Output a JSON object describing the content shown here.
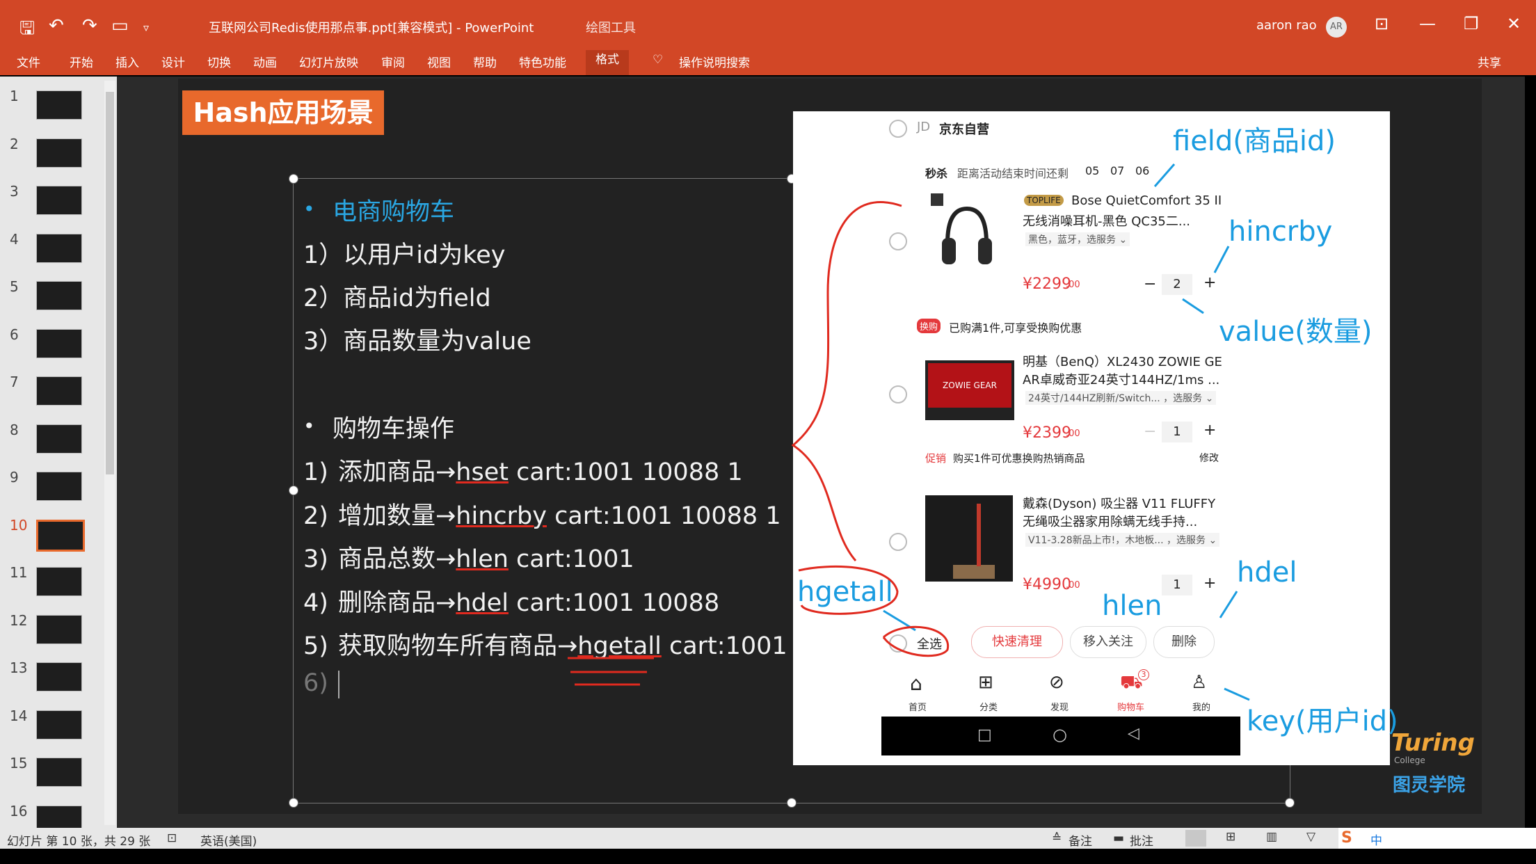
{
  "window": {
    "title": "互联网公司Redis使用那点事.ppt[兼容模式] - PowerPoint",
    "context_tab_group": "绘图工具",
    "user_name": "aaron rao",
    "user_initials": "AR"
  },
  "ribbon": {
    "tabs": [
      "文件",
      "开始",
      "插入",
      "设计",
      "切换",
      "动画",
      "幻灯片放映",
      "审阅",
      "视图",
      "帮助",
      "特色功能",
      "格式"
    ],
    "search": "操作说明搜索",
    "share": "共享"
  },
  "thumbnails": [
    "1",
    "2",
    "3",
    "4",
    "5",
    "6",
    "7",
    "8",
    "9",
    "10",
    "11",
    "12",
    "13",
    "14",
    "15",
    "16"
  ],
  "slide": {
    "title": "Hash应用场景",
    "section1": "电商购物车",
    "lines1": [
      "1）以用户id为key",
      "2）商品id为field",
      "3）商品数量为value"
    ],
    "section2": "购物车操作",
    "ops": [
      {
        "num": "1)",
        "label": "添加商品",
        "cmd": "hset",
        "args": " cart:1001 10088 1"
      },
      {
        "num": "2)",
        "label": "增加数量",
        "cmd": "hincrby",
        "args": " cart:1001 10088 1"
      },
      {
        "num": "3)",
        "label": "商品总数",
        "cmd": "hlen",
        "args": " cart:1001"
      },
      {
        "num": "4)",
        "label": "删除商品",
        "cmd": "hdel",
        "args": " cart:1001 10088"
      },
      {
        "num": "5)",
        "label": "获取购物车所有商品",
        "cmd": "hgetall",
        "args": " cart:1001"
      }
    ],
    "line6": "6)",
    "arrow": "→"
  },
  "phone": {
    "store": "京东自营",
    "jd": "JD",
    "flash_label": "秒杀",
    "flash_text": "距离活动结束时间还剩",
    "countdown": [
      "05",
      "07",
      "06"
    ],
    "items": [
      {
        "tag": "TOPLIFE",
        "name1": "Bose QuietComfort 35 II",
        "name2": "无线消噪耳机-黑色 QC35二...",
        "spec": "黑色，蓝牙，选服务 ⌄",
        "price": "¥2299",
        "cents": ".00",
        "qty": "2"
      },
      {
        "name1": "明基（BenQ）XL2430 ZOWIE GE",
        "name2": "AR卓威奇亚24英寸144HZ/1ms ...",
        "spec": "24英寸/144HZ刷新/Switch... ，选服务 ⌄",
        "price": "¥2399",
        "cents": ".00",
        "qty": "1",
        "img_text": "ZOWIE GEAR"
      },
      {
        "name1": "戴森(Dyson) 吸尘器 V11 FLUFFY",
        "name2": "无绳吸尘器家用除螨无线手持...",
        "spec": "V11-3.28新品上市!，木地板... ，选服务 ⌄",
        "price": "¥4990",
        "cents": ".00",
        "qty": "1"
      }
    ],
    "swap_badge": "换购",
    "swap_text": "已购满1件,可享受换购优惠",
    "promo_badge": "促销",
    "promo_text": "购买1件可优惠换购热销商品",
    "promo_action": "修改",
    "select_all": "全选",
    "quick_clear": "快速清理",
    "move_follow": "移入关注",
    "delete": "删除",
    "nav": [
      "首页",
      "分类",
      "发现",
      "购物车",
      "我的"
    ],
    "cart_badge": "3"
  },
  "annotations": {
    "field": "field(商品id)",
    "hincrby": "hincrby",
    "value": "value(数量)",
    "hgetall": "hgetall",
    "hlen": "hlen",
    "hdel": "hdel",
    "key": "key(用户id)"
  },
  "logo": {
    "name": "Turing",
    "sub": "College",
    "cn": "图灵学院"
  },
  "status": {
    "slide_info": "幻灯片 第 10 张，共 29 张",
    "language": "英语(美国)",
    "notes": "备注",
    "comments": "批注"
  },
  "colors": {
    "ribbon": "#d24726",
    "accent": "#e8692c",
    "blue": "#1a9ce0",
    "red": "#e4393c"
  }
}
